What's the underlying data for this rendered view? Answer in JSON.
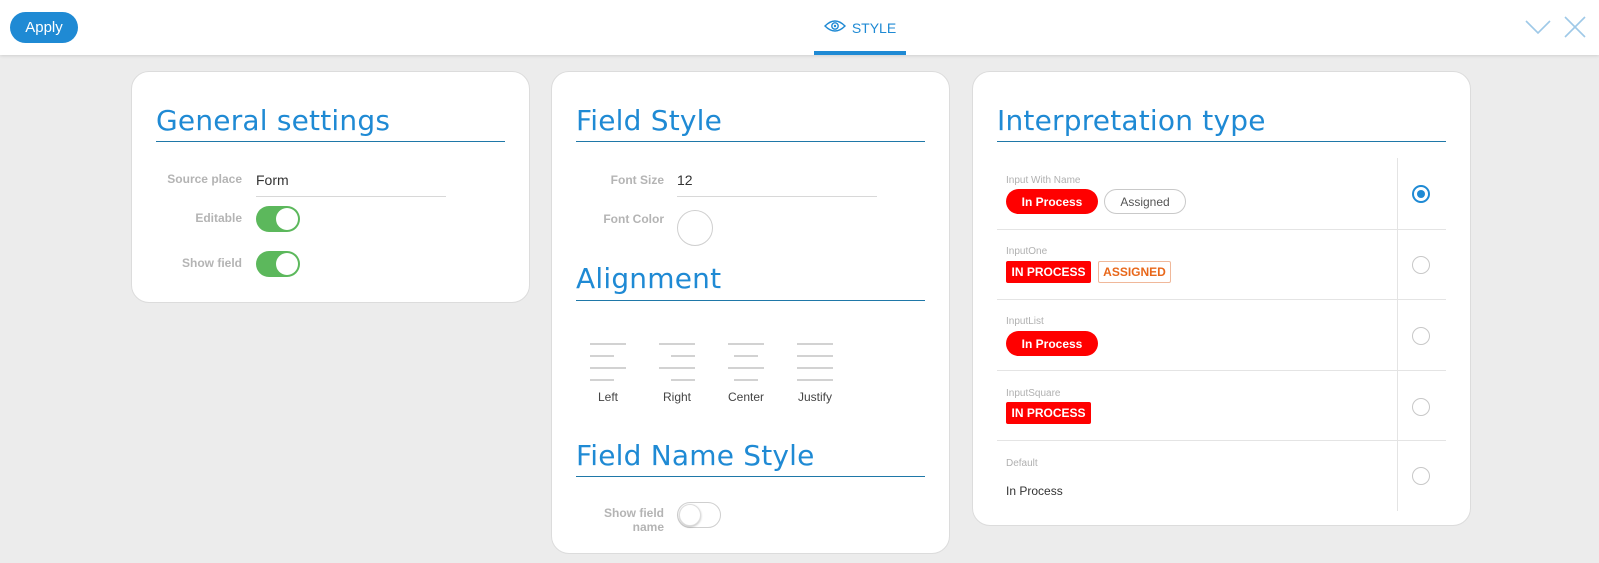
{
  "header": {
    "apply_label": "Apply",
    "tab_label": "STYLE",
    "icons": [
      "eye-icon",
      "chevron-down-icon",
      "close-icon"
    ],
    "accent": "#1f8ad4"
  },
  "general": {
    "title": "General settings",
    "source_place_label": "Source place",
    "source_place_value": "Form",
    "editable_label": "Editable",
    "editable_on": true,
    "show_field_label": "Show field",
    "show_field_on": true
  },
  "field_style": {
    "title": "Field Style",
    "font_size_label": "Font Size",
    "font_size_value": "12",
    "font_color_label": "Font Color",
    "font_color_value": "#ffffff"
  },
  "alignment": {
    "title": "Alignment",
    "options": [
      "Left",
      "Right",
      "Center",
      "Justify"
    ]
  },
  "field_name_style": {
    "title": "Field Name Style",
    "show_field_name_label_1": "Show field",
    "show_field_name_label_2": "name",
    "show_field_name_on": false
  },
  "interpretation": {
    "title": "Interpretation type",
    "rows": [
      {
        "name": "Input With Name",
        "status": "In Process",
        "assigned": "Assigned",
        "selected": true
      },
      {
        "name": "InputOne",
        "status": "IN PROCESS",
        "assigned": "ASSIGNED",
        "selected": false
      },
      {
        "name": "InputList",
        "status": "In Process",
        "selected": false
      },
      {
        "name": "InputSquare",
        "status": "IN PROCESS",
        "selected": false
      },
      {
        "name": "Default",
        "status": "In Process",
        "selected": false
      }
    ],
    "status_color": "#ff0000"
  }
}
